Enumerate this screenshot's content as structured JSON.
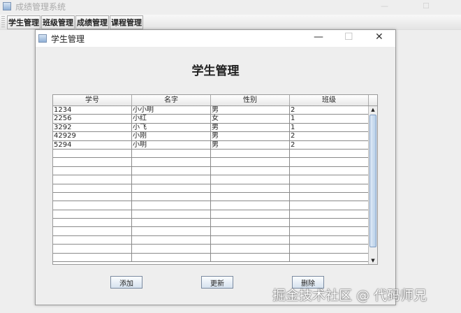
{
  "app": {
    "title": "成绩管理系统"
  },
  "toolbar": {
    "tabs": [
      "学生管理",
      "班级管理",
      "成绩管理",
      "课程管理"
    ]
  },
  "dialog": {
    "title": "学生管理",
    "heading": "学生管理",
    "columns": [
      "学号",
      "名字",
      "性别",
      "班级"
    ],
    "rows": [
      [
        "1234",
        "小小明",
        "男",
        "2"
      ],
      [
        "2256",
        "小红",
        "女",
        "1"
      ],
      [
        "3292",
        "小飞",
        "男",
        "1"
      ],
      [
        "42929",
        "小刚",
        "男",
        "2"
      ],
      [
        "5294",
        "小明",
        "男",
        "2"
      ]
    ],
    "buttons": {
      "add": "添加",
      "update": "更新",
      "delete": "删除"
    }
  },
  "watermark": "掘金技术社区 @ 代码师兄"
}
